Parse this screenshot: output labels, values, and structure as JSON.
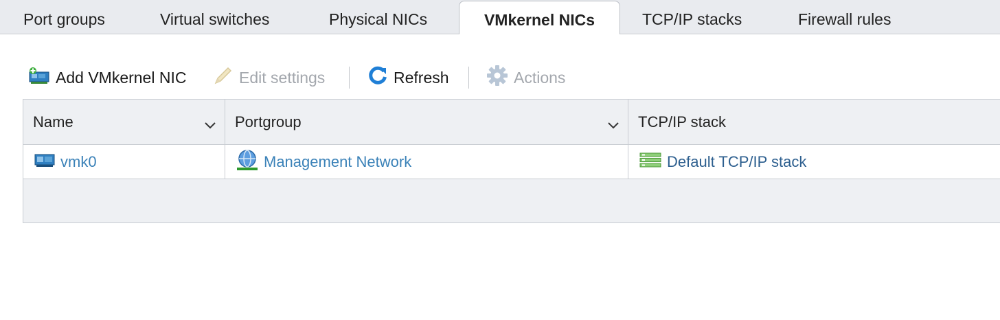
{
  "tabs": [
    {
      "label": "Port groups",
      "active": false
    },
    {
      "label": "Virtual switches",
      "active": false
    },
    {
      "label": "Physical NICs",
      "active": false
    },
    {
      "label": "VMkernel NICs",
      "active": true
    },
    {
      "label": "TCP/IP stacks",
      "active": false
    },
    {
      "label": "Firewall rules",
      "active": false
    }
  ],
  "toolbar": {
    "add_label": "Add VMkernel NIC",
    "edit_label": "Edit settings",
    "refresh_label": "Refresh",
    "actions_label": "Actions"
  },
  "table": {
    "columns": [
      "Name",
      "Portgroup",
      "TCP/IP stack"
    ],
    "rows": [
      {
        "name": "vmk0",
        "portgroup": "Management Network",
        "tcpip_stack": "Default TCP/IP stack"
      }
    ]
  },
  "colors": {
    "link": "#3b82b8",
    "link_dark": "#2d5f8f",
    "header_bg": "#eef0f3",
    "tabbar_bg": "#e9ebef"
  }
}
